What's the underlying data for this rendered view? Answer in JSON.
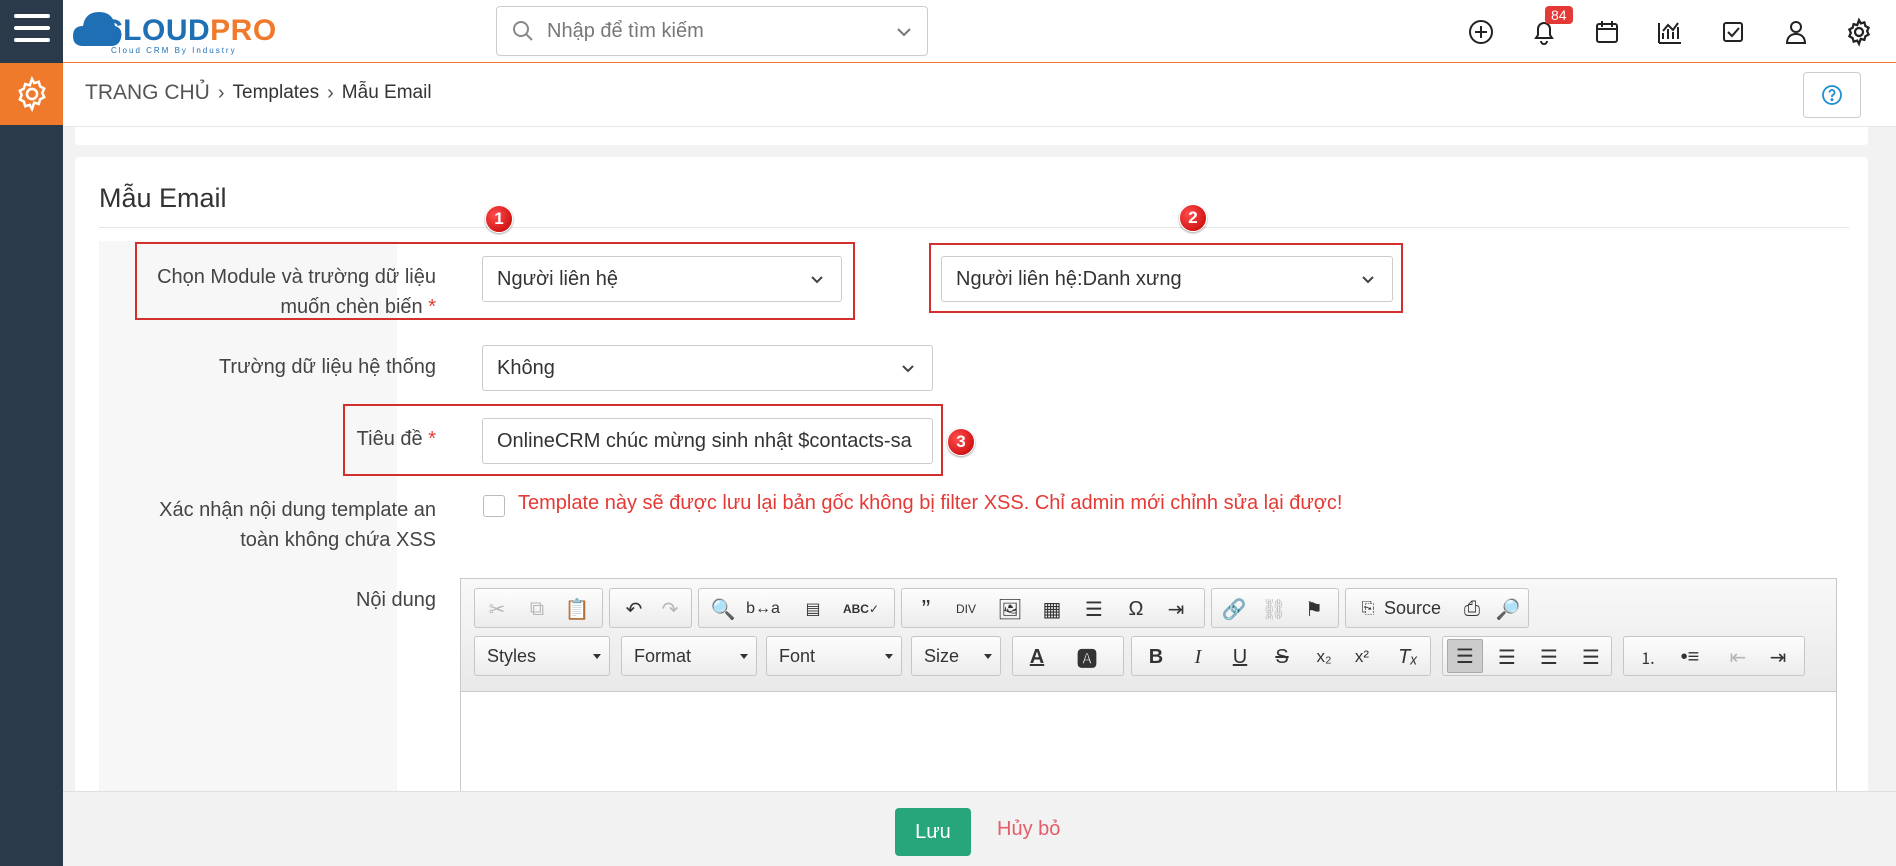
{
  "header": {
    "logo": {
      "word_part1": "CLOUD",
      "word_part2": "PRO",
      "tagline": "Cloud CRM By Industry"
    },
    "search": {
      "placeholder": "Nhập để tìm kiếm"
    },
    "notification_count": "84",
    "icons": [
      "add-icon",
      "bell-icon",
      "calendar-icon",
      "chart-icon",
      "task-icon",
      "user-icon",
      "gear-icon"
    ]
  },
  "breadcrumb": {
    "home": "TRANG CHỦ",
    "items": [
      "Templates",
      "Mẫu Email"
    ]
  },
  "panel": {
    "title": "Mẫu Email"
  },
  "form": {
    "module_label_line1": "Chọn Module và trường dữ liệu",
    "module_label_line2": "muốn chèn biến",
    "required_mark": "*",
    "module_value": "Người liên hệ",
    "field_value": "Người liên hệ:Danh xưng",
    "system_field_label": "Trường dữ liệu hệ thống",
    "system_field_value": "Không",
    "subject_label": "Tiêu đề",
    "subject_value": "OnlineCRM chúc mừng sinh nhật $contacts-sa",
    "xss_label_line1": "Xác nhận nội dung template an",
    "xss_label_line2": "toàn không chứa XSS",
    "xss_warning": "Template này sẽ được lưu lại bản gốc không bị filter XSS. Chỉ admin mới chỉnh sửa lại được!",
    "content_label": "Nội dung"
  },
  "annotations": [
    "1",
    "2",
    "3"
  ],
  "editor": {
    "source_label": "Source",
    "combos": {
      "styles": "Styles",
      "format": "Format",
      "font": "Font",
      "size": "Size"
    }
  },
  "footer": {
    "save_label": "Lưu",
    "cancel_label": "Hủy bỏ"
  },
  "colors": {
    "accent": "#f07a2c",
    "brand_blue": "#1f6fb5",
    "save_green": "#26a67a",
    "annotation_red": "#d32f2f"
  }
}
